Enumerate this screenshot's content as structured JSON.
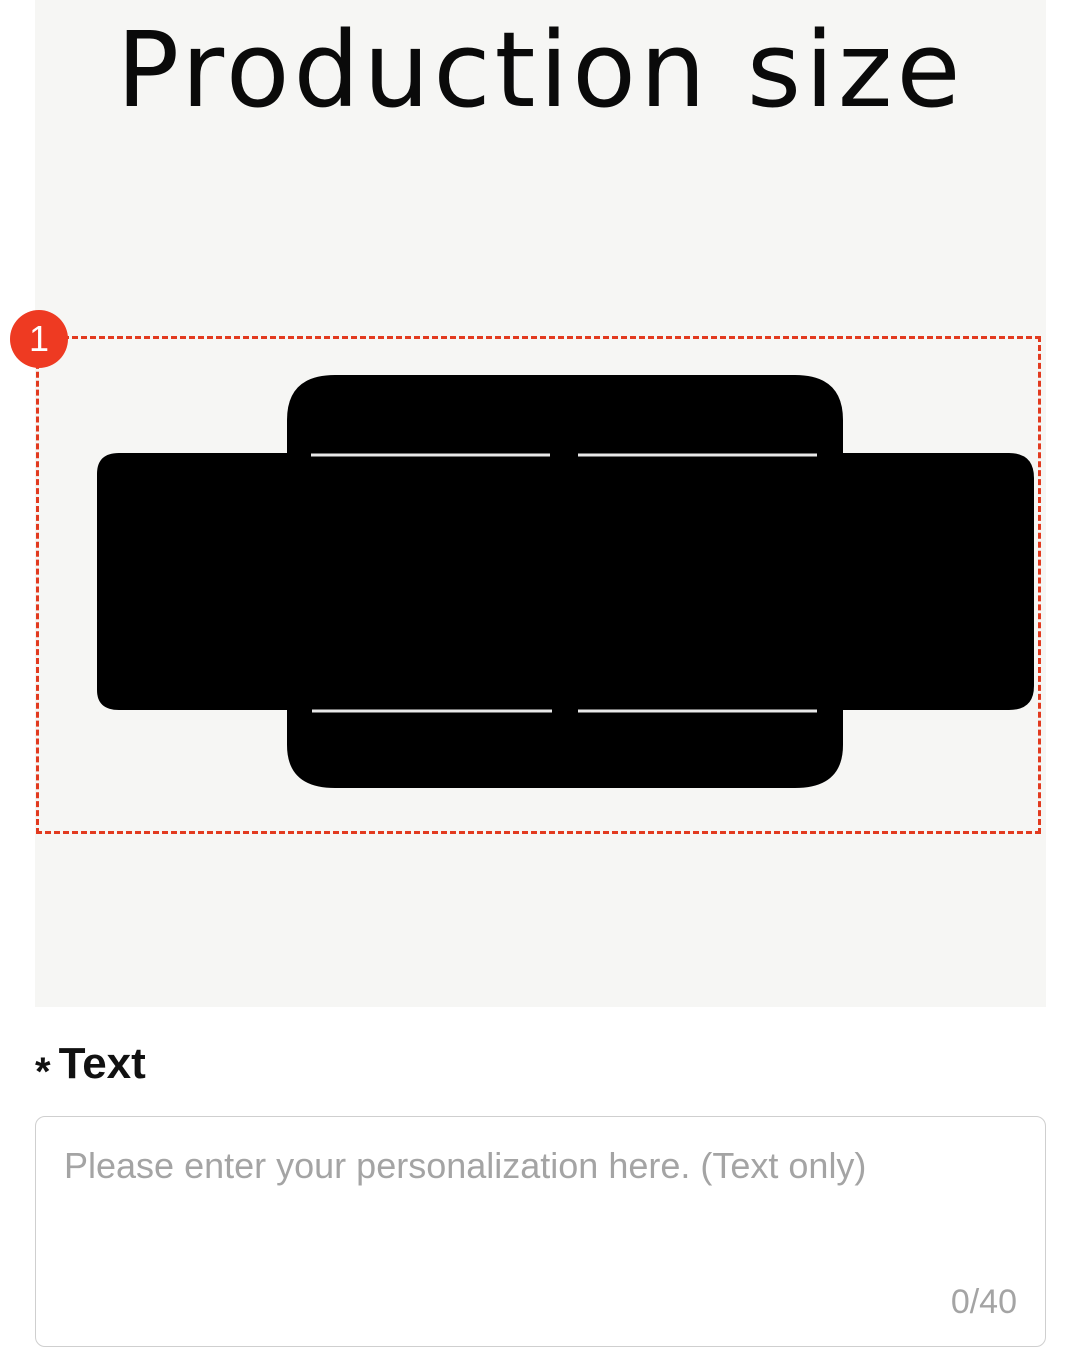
{
  "preview": {
    "title": "Production size",
    "zone_badge": "1",
    "colors": {
      "panel_background": "#f6f6f4",
      "shape_fill": "#000000",
      "zone_border": "#e23a1f",
      "badge_fill": "#ee3a22"
    }
  },
  "form": {
    "required_mark": "*",
    "label": "Text",
    "placeholder": "Please enter your personalization here. (Text only)",
    "value": "",
    "counter": "0/40"
  }
}
